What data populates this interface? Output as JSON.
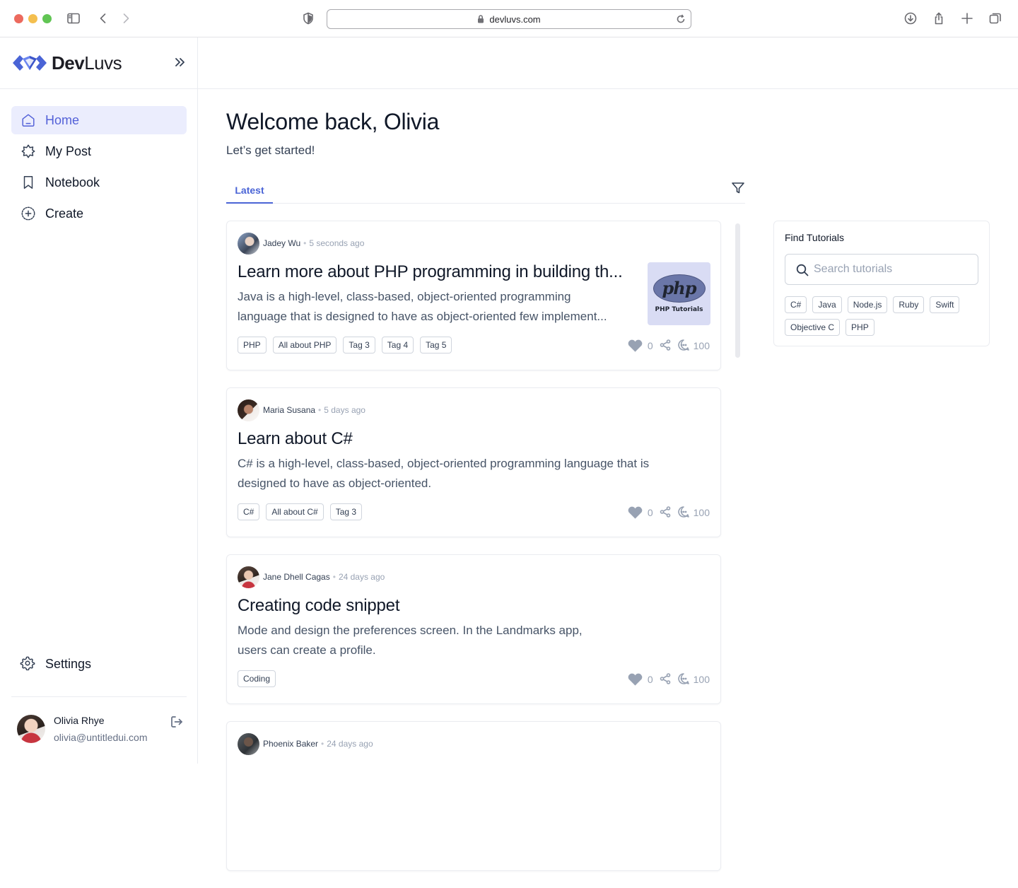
{
  "browser": {
    "url": "devluvs.com"
  },
  "sidebar": {
    "brand_prefix": "Dev",
    "brand_suffix": "Luvs",
    "items": [
      {
        "label": "Home",
        "icon": "home-icon",
        "active": true
      },
      {
        "label": "My Post",
        "icon": "star-icon",
        "active": false
      },
      {
        "label": "Notebook",
        "icon": "bookmark-icon",
        "active": false
      },
      {
        "label": "Create",
        "icon": "plus-circle-icon",
        "active": false
      }
    ],
    "settings_label": "Settings",
    "user": {
      "name": "Olivia Rhye",
      "email": "olivia@untitledui.com"
    }
  },
  "main": {
    "welcome": "Welcome back, Olivia",
    "subtitle": "Let’s get started!",
    "tabs": [
      {
        "label": "Latest",
        "active": true
      }
    ]
  },
  "posts": [
    {
      "author": "Jadey Wu",
      "time": "5 seconds ago",
      "title": "Learn more about PHP programming in building th...",
      "desc_lines": [
        "Java is a high-level, class-based, object-oriented programming",
        "language that is designed to have as object-oriented few implement..."
      ],
      "thumbnail": {
        "logo": "php",
        "caption": "PHP Tutorials"
      },
      "tags": [
        "PHP",
        "All about PHP",
        "Tag 3",
        "Tag 4",
        "Tag 5"
      ],
      "likes": "0",
      "comments": "100"
    },
    {
      "author": "Maria Susana",
      "time": "5 days ago",
      "title": "Learn about C#",
      "desc_lines": [
        "C# is a high-level, class-based, object-oriented programming language that is",
        "designed to have as object-oriented."
      ],
      "tags": [
        "C#",
        "All about C#",
        "Tag 3"
      ],
      "likes": "0",
      "comments": "100"
    },
    {
      "author": "Jane Dhell Cagas",
      "time": "24 days ago",
      "title": "Creating code snippet",
      "desc_lines": [
        "Mode and design the preferences screen. In the Landmarks app,",
        "users can create a profile."
      ],
      "tags": [
        "Coding"
      ],
      "likes": "0",
      "comments": "100"
    },
    {
      "author": "Phoenix Baker",
      "time": "24 days ago"
    }
  ],
  "tutorials": {
    "title": "Find Tutorials",
    "search_placeholder": "Search tutorials",
    "tags": [
      "C#",
      "Java",
      "Node.js",
      "Ruby",
      "Swift",
      "Objective C",
      "PHP"
    ]
  },
  "colors": {
    "accent": "#4a64d6",
    "active_bg": "#ebedfd",
    "brand_blue": "#4f6ee6"
  }
}
